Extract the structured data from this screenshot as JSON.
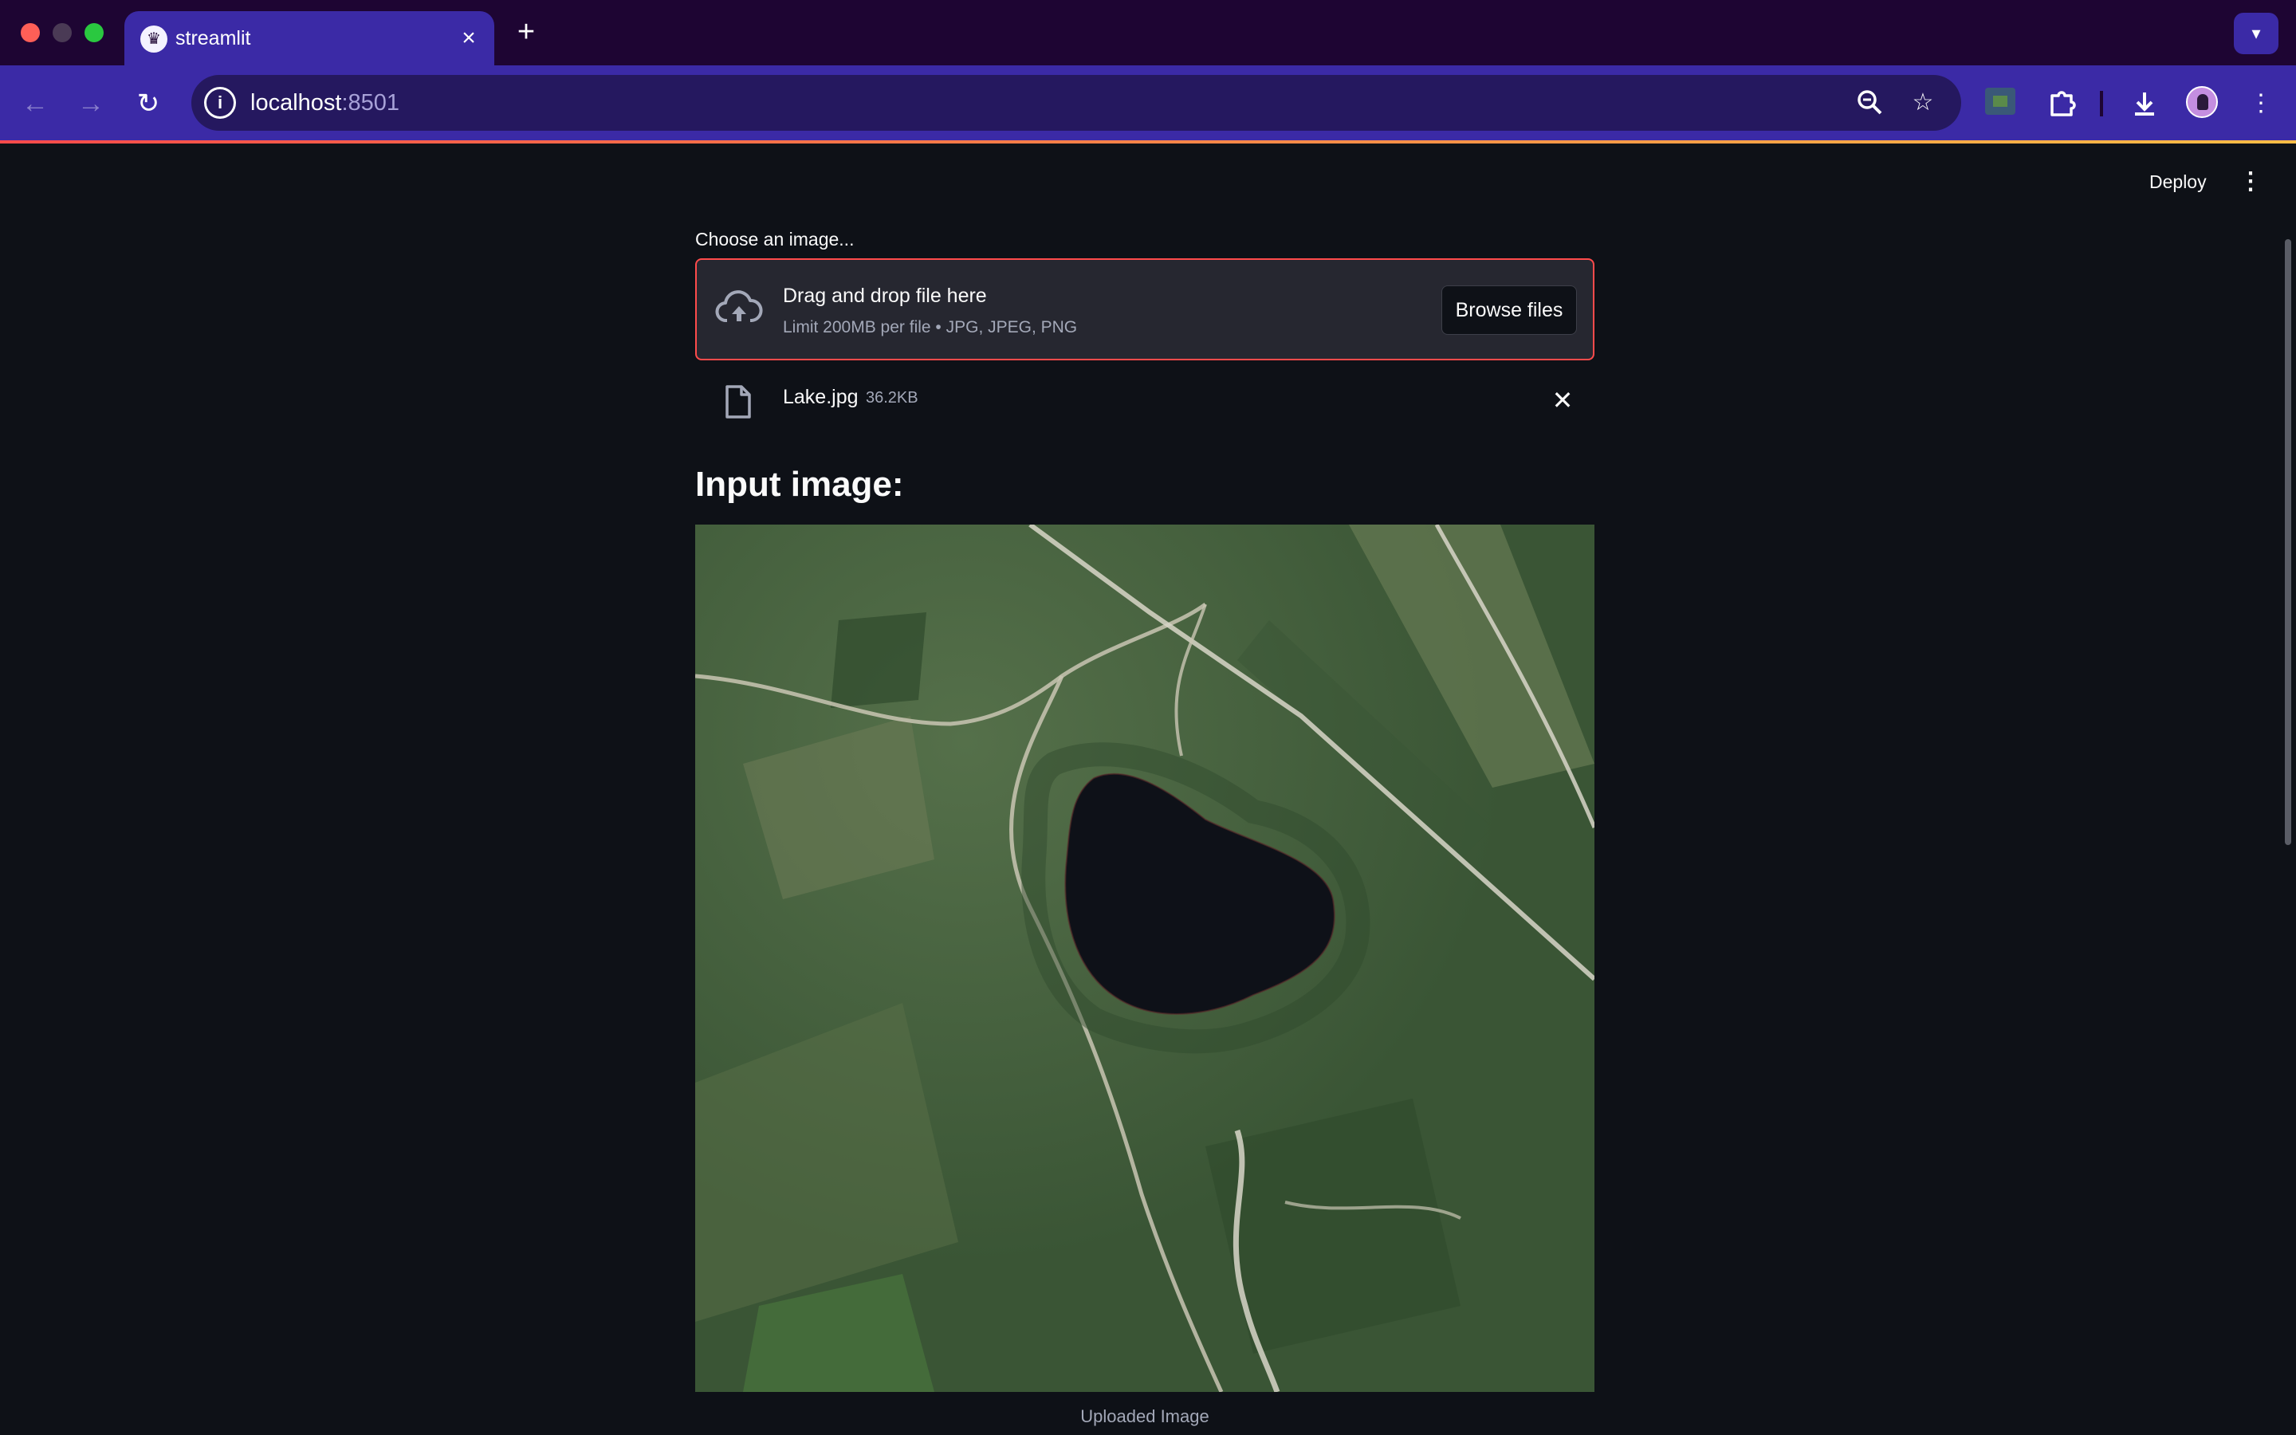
{
  "browser": {
    "tab_title": "streamlit",
    "url_host": "localhost",
    "url_port": ":8501"
  },
  "app": {
    "header": {
      "deploy_label": "Deploy"
    },
    "uploader": {
      "label": "Choose an image...",
      "dropzone_title": "Drag and drop file here",
      "dropzone_limits": "Limit 200MB per file • JPG, JPEG, PNG",
      "browse_label": "Browse files"
    },
    "uploaded_file": {
      "name": "Lake.jpg",
      "size": "36.2KB"
    },
    "section_heading": "Input image:",
    "image_caption": "Uploaded Image"
  },
  "colors": {
    "app_background": "#0e1117",
    "accent": "#ff4b4b",
    "browser_frame": "#3b2aa6"
  },
  "icons": [
    "streamlit-crown-icon",
    "close-icon",
    "plus-icon",
    "chevron-down-icon",
    "back-arrow-icon",
    "forward-arrow-icon",
    "reload-icon",
    "info-icon",
    "zoom-icon",
    "star-icon",
    "extension-icon",
    "puzzle-icon",
    "download-icon",
    "profile-avatar",
    "more-vert-icon",
    "cloud-upload-icon",
    "file-icon"
  ]
}
